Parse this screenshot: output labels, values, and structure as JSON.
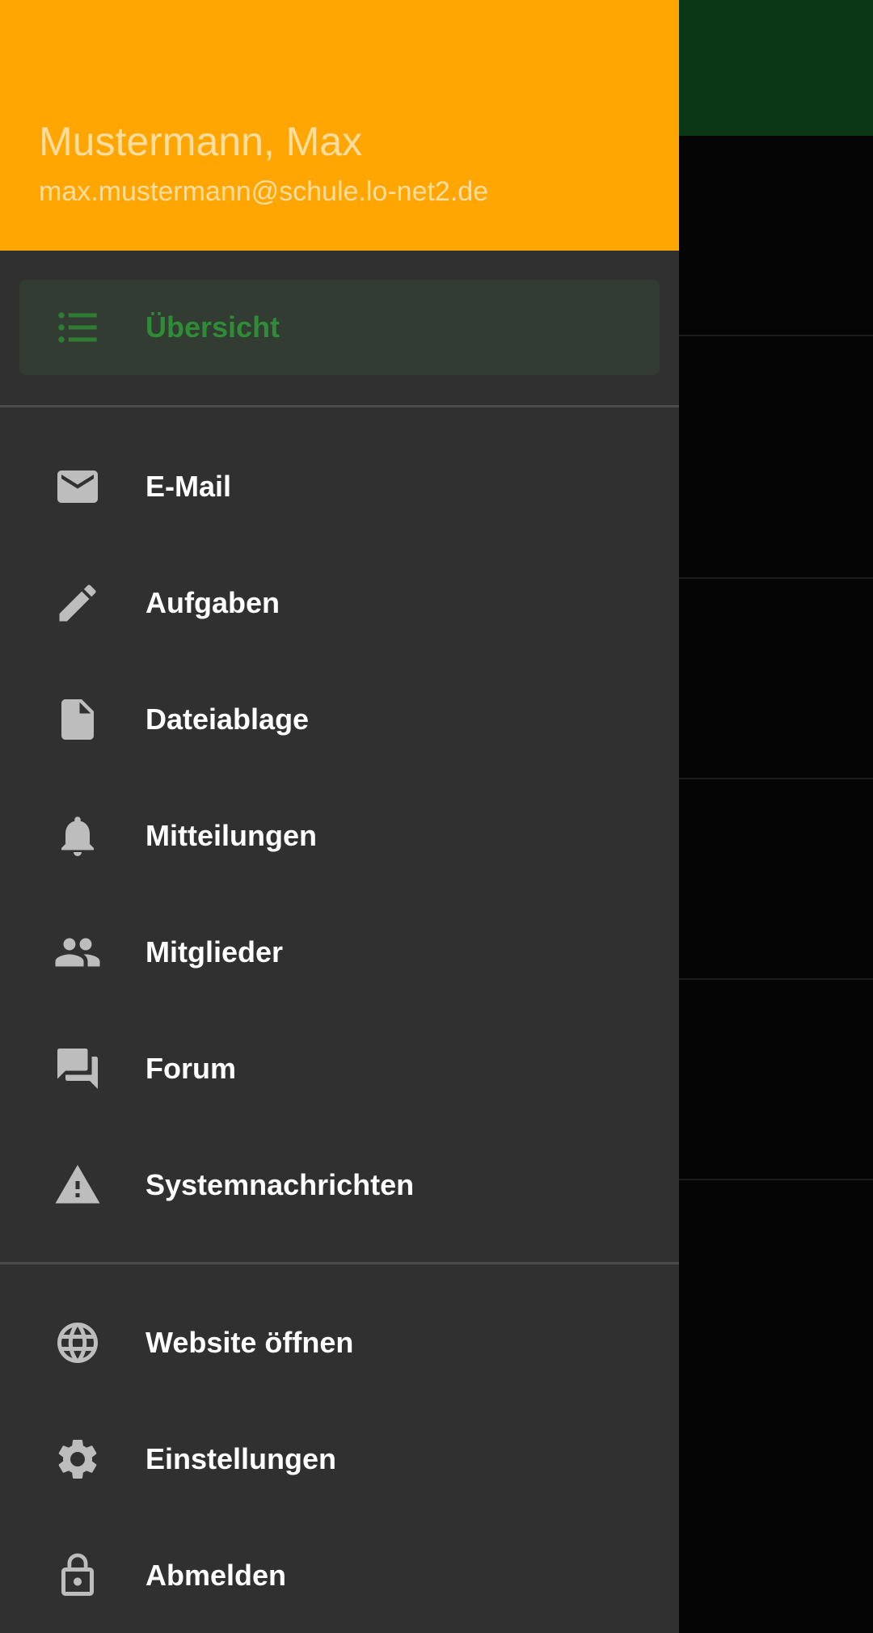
{
  "colors": {
    "header_bg": "#ffa602",
    "drawer_bg": "#303030",
    "active_color": "#2e8b36",
    "toolbar_bg": "#0b3716"
  },
  "header": {
    "name": "Mustermann, Max",
    "email": "max.mustermann@schule.lo-net2.de"
  },
  "nav": {
    "active": {
      "label": "Übersicht",
      "icon": "list-icon"
    },
    "items": [
      {
        "label": "E-Mail",
        "icon": "mail-icon"
      },
      {
        "label": "Aufgaben",
        "icon": "pencil-icon"
      },
      {
        "label": "Dateiablage",
        "icon": "file-icon"
      },
      {
        "label": "Mitteilungen",
        "icon": "bell-icon"
      },
      {
        "label": "Mitglieder",
        "icon": "people-icon"
      },
      {
        "label": "Forum",
        "icon": "forum-icon"
      },
      {
        "label": "Systemnachrichten",
        "icon": "warning-icon"
      }
    ],
    "footer_items": [
      {
        "label": "Website öffnen",
        "icon": "globe-icon"
      },
      {
        "label": "Einstellungen",
        "icon": "gear-icon"
      },
      {
        "label": "Abmelden",
        "icon": "lock-open-icon"
      }
    ]
  }
}
